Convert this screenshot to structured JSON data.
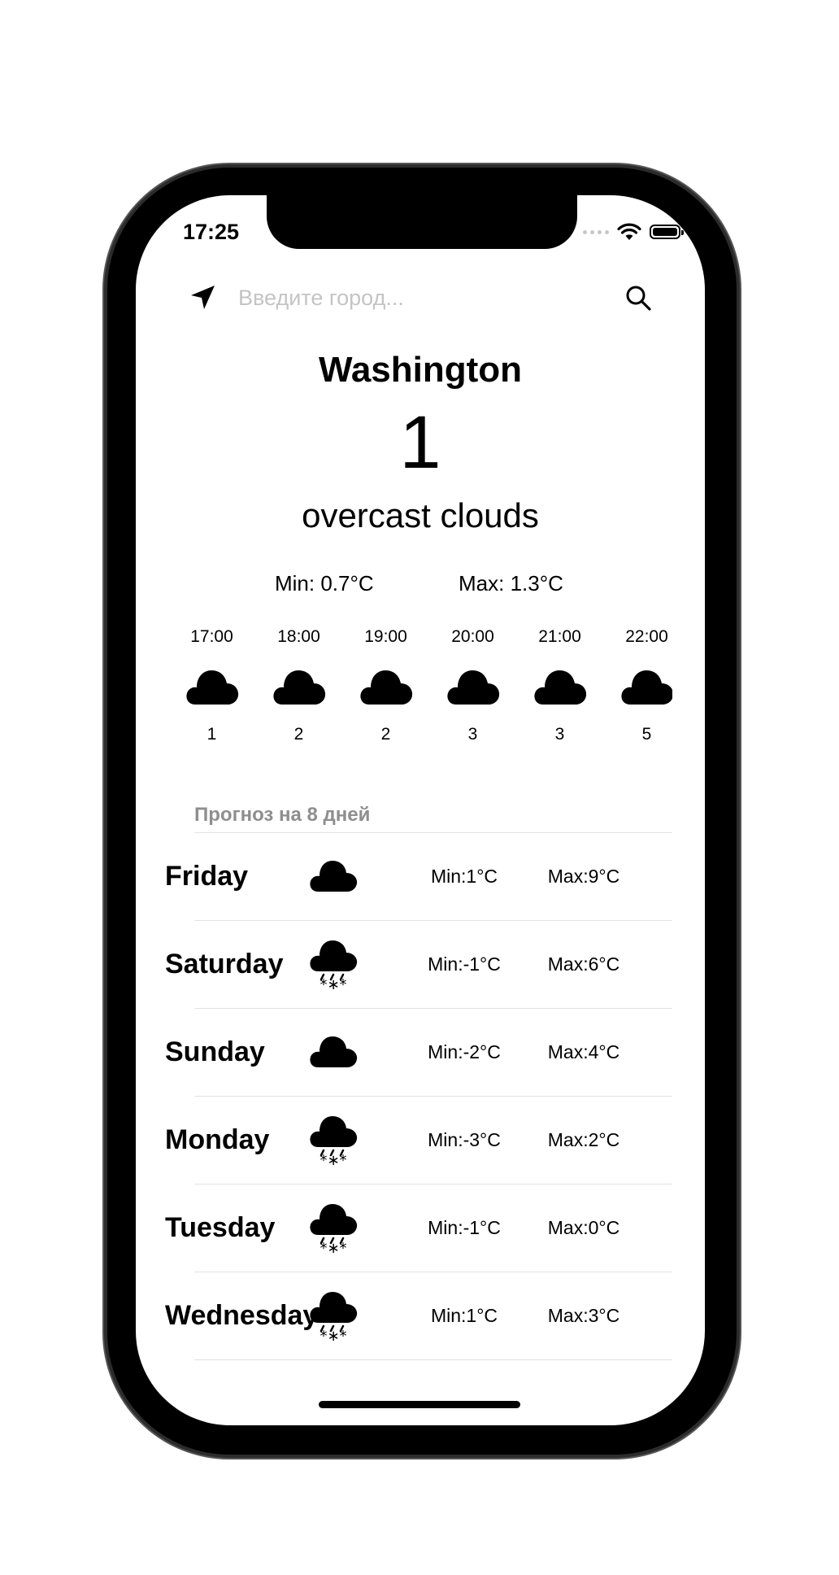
{
  "status": {
    "time": "17:25"
  },
  "search": {
    "placeholder": "Введите город..."
  },
  "current": {
    "city": "Washington",
    "temp": "1",
    "description": "overcast clouds",
    "min": "Min: 0.7°C",
    "max": "Max: 1.3°C"
  },
  "hourly": [
    {
      "time": "17:00",
      "icon": "cloud-icon",
      "temp": "1"
    },
    {
      "time": "18:00",
      "icon": "cloud-icon",
      "temp": "2"
    },
    {
      "time": "19:00",
      "icon": "cloud-icon",
      "temp": "2"
    },
    {
      "time": "20:00",
      "icon": "cloud-icon",
      "temp": "3"
    },
    {
      "time": "21:00",
      "icon": "cloud-icon",
      "temp": "3"
    },
    {
      "time": "22:00",
      "icon": "cloud-icon",
      "temp": "5"
    }
  ],
  "forecast": {
    "title": "Прогноз на 8 дней",
    "days": [
      {
        "day": "Friday",
        "icon": "cloud-icon",
        "min": "Min:1°C",
        "max": "Max:9°C"
      },
      {
        "day": "Saturday",
        "icon": "cloud-snow-icon",
        "min": "Min:-1°C",
        "max": "Max:6°C"
      },
      {
        "day": "Sunday",
        "icon": "cloud-icon",
        "min": "Min:-2°C",
        "max": "Max:4°C"
      },
      {
        "day": "Monday",
        "icon": "cloud-snow-icon",
        "min": "Min:-3°C",
        "max": "Max:2°C"
      },
      {
        "day": "Tuesday",
        "icon": "cloud-snow-icon",
        "min": "Min:-1°C",
        "max": "Max:0°C"
      },
      {
        "day": "Wednesday",
        "icon": "cloud-snow-icon",
        "min": "Min:1°C",
        "max": "Max:3°C"
      }
    ]
  }
}
